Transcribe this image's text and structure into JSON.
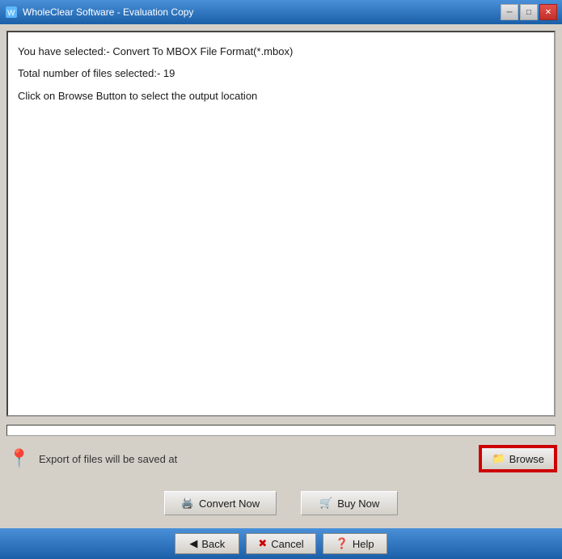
{
  "titleBar": {
    "title": "WholeClear Software - Evaluation Copy",
    "minimizeLabel": "─",
    "maximizeLabel": "□",
    "closeLabel": "✕"
  },
  "infoArea": {
    "line1": "You have selected:- Convert To MBOX File Format(*.mbox)",
    "line2": "Total number of files selected:- 19",
    "line3": "Click on Browse Button to select the output location"
  },
  "browseRow": {
    "label": "Export of files will be saved at",
    "browseButton": "Browse"
  },
  "actionButtons": {
    "convertNow": "Convert Now",
    "buyNow": "Buy Now"
  },
  "navBar": {
    "back": "Back",
    "cancel": "Cancel",
    "help": "Help"
  },
  "icons": {
    "folder": "🗁",
    "convert": "🖨",
    "cart": "🛒",
    "back": "◀",
    "cancel": "✖",
    "help": "❓",
    "mapPin": "📍"
  }
}
